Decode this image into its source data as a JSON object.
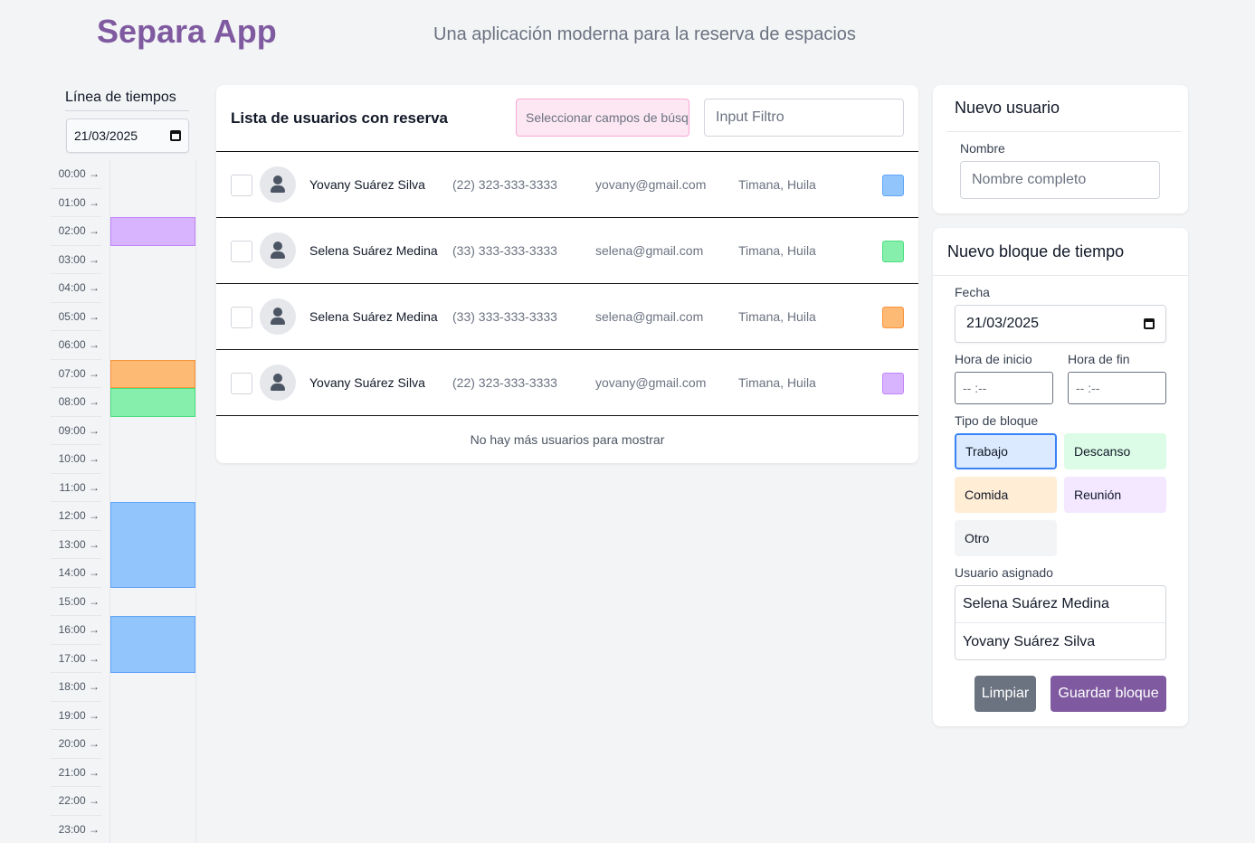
{
  "header": {
    "title": "Separa App",
    "subtitle": "Una aplicación moderna para la reserva de espacios"
  },
  "timeline": {
    "title": "Línea de tiempos",
    "date": "21/03/2025",
    "hours": [
      "00:00 →",
      "01:00 →",
      "02:00 →",
      "03:00 →",
      "04:00 →",
      "05:00 →",
      "06:00 →",
      "07:00 →",
      "08:00 →",
      "09:00 →",
      "10:00 →",
      "11:00 →",
      "12:00 →",
      "13:00 →",
      "14:00 →",
      "15:00 →",
      "16:00 →",
      "17:00 →",
      "18:00 →",
      "19:00 →",
      "20:00 →",
      "21:00 →",
      "22:00 →",
      "23:00 →"
    ],
    "blocks": [
      {
        "start": 2,
        "end": 3,
        "color": "#d8b4fe",
        "border": "#c084fc"
      },
      {
        "start": 7,
        "end": 8,
        "color": "#fdba74",
        "border": "#fb923c"
      },
      {
        "start": 8,
        "end": 9,
        "color": "#86efac",
        "border": "#4ade80"
      },
      {
        "start": 12,
        "end": 15,
        "color": "#93c5fd",
        "border": "#60a5fa"
      },
      {
        "start": 16,
        "end": 18,
        "color": "#93c5fd",
        "border": "#60a5fa"
      }
    ]
  },
  "list": {
    "title": "Lista de usuarios con reserva",
    "select_fields_placeholder": "Seleccionar campos de búsqueda",
    "filter_placeholder": "Input Filtro",
    "rows": [
      {
        "name": "Yovany Suárez Silva",
        "phone": "(22) 323-333-3333",
        "email": "yovany@gmail.com",
        "location": "Timana, Huila",
        "color": "#93c5fd",
        "border": "#60a5fa"
      },
      {
        "name": "Selena Suárez Medina",
        "phone": "(33) 333-333-3333",
        "email": "selena@gmail.com",
        "location": "Timana, Huila",
        "color": "#86efac",
        "border": "#4ade80"
      },
      {
        "name": "Selena Suárez Medina",
        "phone": "(33) 333-333-3333",
        "email": "selena@gmail.com",
        "location": "Timana, Huila",
        "color": "#fdba74",
        "border": "#fb923c"
      },
      {
        "name": "Yovany Suárez Silva",
        "phone": "(22) 323-333-3333",
        "email": "yovany@gmail.com",
        "location": "Timana, Huila",
        "color": "#d8b4fe",
        "border": "#c084fc"
      }
    ],
    "empty_text": "No hay más usuarios para mostrar"
  },
  "new_user": {
    "title": "Nuevo usuario",
    "name_label": "Nombre",
    "name_placeholder": "Nombre completo"
  },
  "new_block": {
    "title": "Nuevo bloque de tiempo",
    "date_label": "Fecha",
    "date_value": "21/03/2025",
    "start_label": "Hora de inicio",
    "end_label": "Hora de fin",
    "time_placeholder": "--  :--",
    "type_label": "Tipo de bloque",
    "types": [
      {
        "label": "Trabajo",
        "bg": "#dbeafe",
        "border": "#3b82f6",
        "selected": true
      },
      {
        "label": "Descanso",
        "bg": "#dcfce7",
        "border": "#dcfce7",
        "selected": false
      },
      {
        "label": "Comida",
        "bg": "#ffedd5",
        "border": "#ffedd5",
        "selected": false
      },
      {
        "label": "Reunión",
        "bg": "#f3e8ff",
        "border": "#f3e8ff",
        "selected": false
      },
      {
        "label": "Otro",
        "bg": "#f3f4f6",
        "border": "#f3f4f6",
        "selected": false
      }
    ],
    "user_label": "Usuario asignado",
    "users": [
      "Selena Suárez Medina",
      "Yovany Suárez Silva"
    ],
    "clear_label": "Limpiar",
    "save_label": "Guardar bloque",
    "clear_color": "#6b7280",
    "save_color": "#7f5aa0"
  }
}
